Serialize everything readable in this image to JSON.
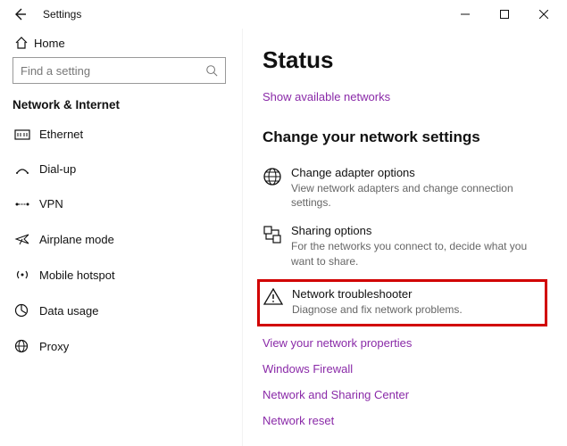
{
  "window": {
    "title": "Settings"
  },
  "sidebar": {
    "home": "Home",
    "search_placeholder": "Find a setting",
    "category": "Network & Internet",
    "items": [
      {
        "label": "Ethernet"
      },
      {
        "label": "Dial-up"
      },
      {
        "label": "VPN"
      },
      {
        "label": "Airplane mode"
      },
      {
        "label": "Mobile hotspot"
      },
      {
        "label": "Data usage"
      },
      {
        "label": "Proxy"
      }
    ]
  },
  "main": {
    "title": "Status",
    "show_networks": "Show available networks",
    "section": "Change your network settings",
    "options": [
      {
        "title": "Change adapter options",
        "desc": "View network adapters and change connection settings."
      },
      {
        "title": "Sharing options",
        "desc": "For the networks you connect to, decide what you want to share."
      },
      {
        "title": "Network troubleshooter",
        "desc": "Diagnose and fix network problems."
      }
    ],
    "links": [
      "View your network properties",
      "Windows Firewall",
      "Network and Sharing Center",
      "Network reset"
    ]
  }
}
